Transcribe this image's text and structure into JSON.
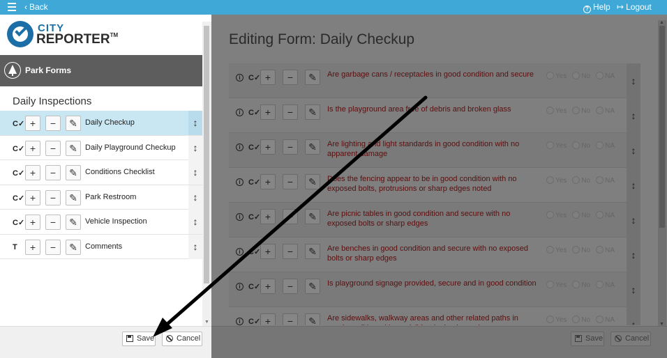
{
  "topbar": {
    "back_label": "Back",
    "help_label": "Help",
    "logout_label": "Logout",
    "background_color": "#3fa8d6"
  },
  "logo": {
    "line1": "CITY",
    "line2": "REPORTER",
    "tm": "TM"
  },
  "left": {
    "header_title": "Park Forms",
    "section_title": "Daily Inspections",
    "forms": [
      {
        "type": "C✓",
        "label": "Daily Checkup",
        "selected": true
      },
      {
        "type": "C✓",
        "label": "Daily Playground Checkup",
        "selected": false
      },
      {
        "type": "C✓",
        "label": "Conditions Checklist",
        "selected": false
      },
      {
        "type": "C✓",
        "label": "Park Restroom",
        "selected": false
      },
      {
        "type": "C✓",
        "label": "Vehicle Inspection",
        "selected": false
      },
      {
        "type": "T",
        "label": "Comments",
        "selected": false
      }
    ],
    "save_label": "Save",
    "cancel_label": "Cancel"
  },
  "right": {
    "title": "Editing Form: Daily Checkup",
    "option_labels": [
      "Yes",
      "No",
      "NA"
    ],
    "questions": [
      "Are garbage cans / receptacles in good condition and secure",
      "Is the playground area free of debris and broken glass",
      "Are lighting and light standards in good condition with no apparent damage",
      "Does the fencing appear to be in good condition with no exposed bolts, protrusions or sharp edges noted",
      "Are picnic tables in good condition and secure with no exposed bolts or sharp edges",
      "Are benches in good condition and secure with no exposed bolts or sharp edges",
      "Is playground signage provided, secure and in good condition",
      "Are sidewalks, walkway areas and other related paths in good condition with no visible tripping hazards"
    ],
    "save_label": "Save",
    "cancel_label": "Cancel"
  },
  "icons": {
    "menu": "hamburger-icon",
    "back": "chevron-left-icon",
    "help": "question-circle-icon",
    "logout": "logout-icon",
    "tree": "tree-icon",
    "add": "plus-icon",
    "remove": "minus-icon",
    "edit": "pencil-icon",
    "reorder": "up-down-arrow-icon",
    "info": "info-icon",
    "save": "floppy-disk-icon",
    "cancel": "ban-icon"
  },
  "colors": {
    "selected_row": "#c8e7f3",
    "header_bar": "#5d5d5d",
    "question_text": "#5b0f0f",
    "overlay": "#7f7f7f",
    "arrow": "#000000"
  }
}
